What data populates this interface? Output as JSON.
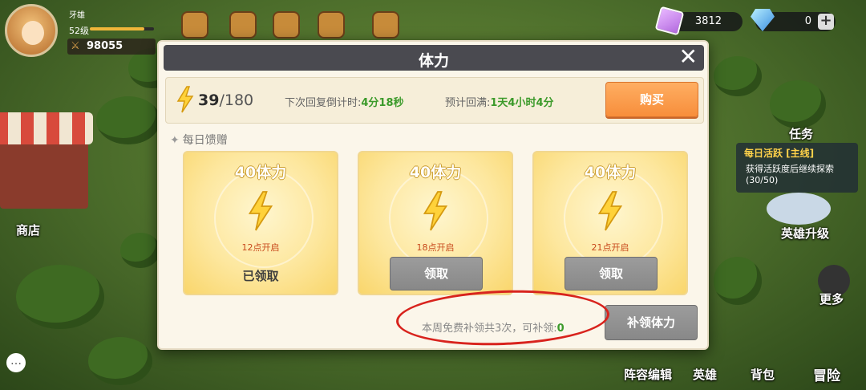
{
  "hud": {
    "player_name": "牙雄",
    "player_level": "52级",
    "level_progress": 0.85,
    "combat_power": "98055",
    "currency_purple": "3812",
    "currency_diamond": "0"
  },
  "world": {
    "shop_label": "商店",
    "quest_header": "任务",
    "quest_title": "每日活跃 [主线]",
    "quest_desc": "获得活跃度后继续探索 (30/50)",
    "hero_upgrade": "英雄升级",
    "more": "更多",
    "formation": "阵容编辑",
    "hero": "英雄",
    "bag": "背包",
    "adventure": "冒险"
  },
  "dialog": {
    "title": "体力",
    "stamina_current": "39",
    "stamina_max": "/180",
    "next_recover_label": "下次回复倒计时:",
    "next_recover_value": "4分18秒",
    "full_label": "预计回满:",
    "full_value": "1天4小时4分",
    "buy_label": "购买",
    "daily_label": "每日馈赠",
    "cards": [
      {
        "title": "40体力",
        "time": "12点开启",
        "status": "已领取",
        "claimed": true
      },
      {
        "title": "40体力",
        "time": "18点开启",
        "button": "领取",
        "claimed": false
      },
      {
        "title": "40体力",
        "time": "21点开启",
        "button": "领取",
        "claimed": false
      }
    ],
    "footer_text": "本周免费补领共3次，可补领:",
    "footer_count": "0",
    "catch_up_label": "补领体力"
  },
  "colors": {
    "accent_orange": "#f78e3b",
    "green_value": "#3b9a2a",
    "annotation_red": "#d8231d"
  }
}
